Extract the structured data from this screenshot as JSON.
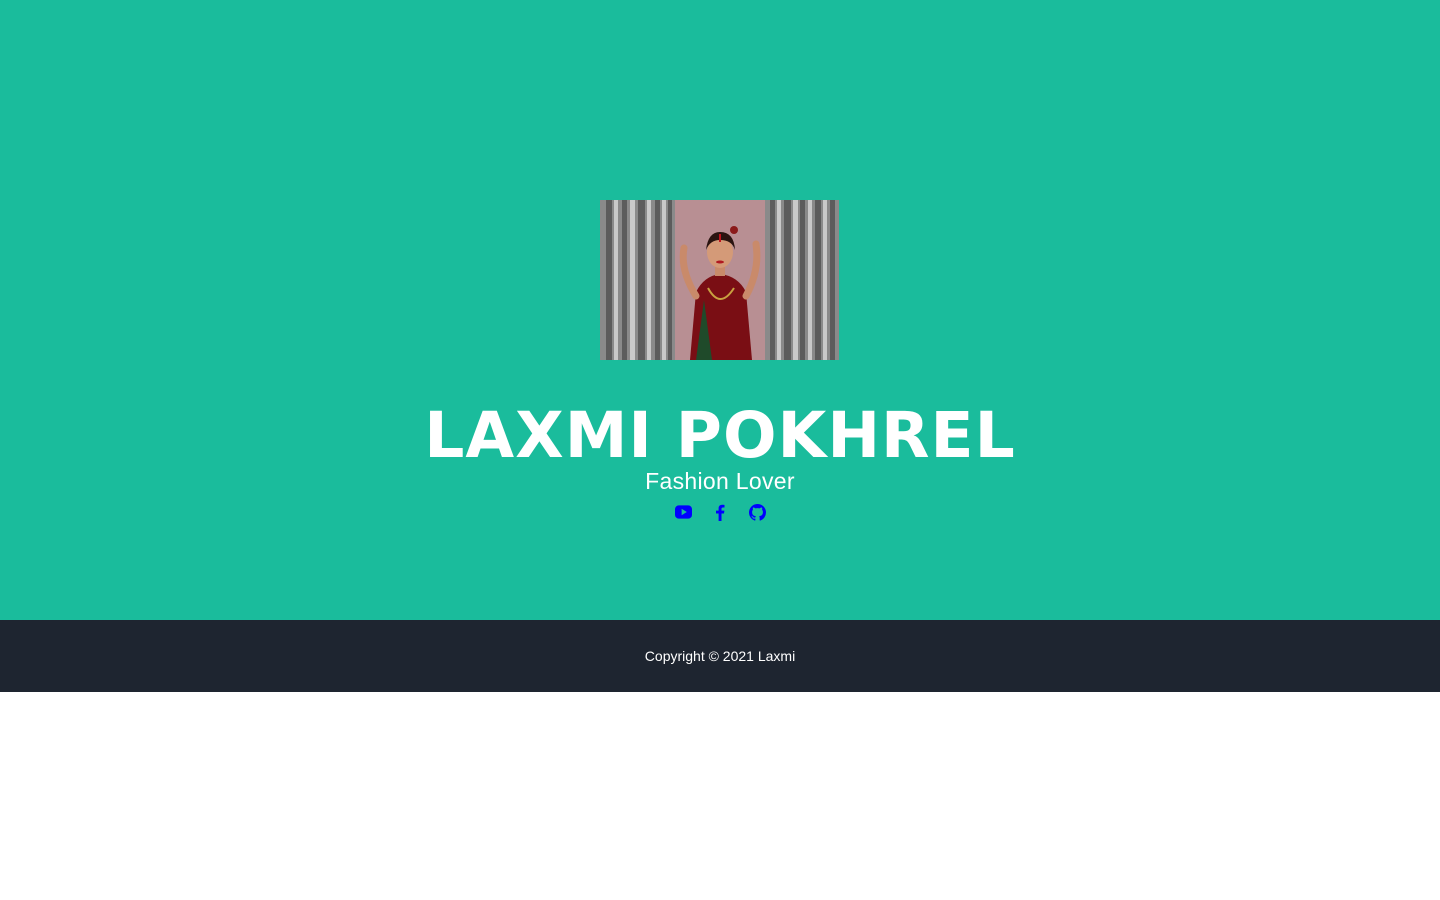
{
  "profile": {
    "name": "LAXMI POKHREL",
    "tagline": "Fashion Lover"
  },
  "social": [
    {
      "icon": "youtube-icon",
      "color": "#0000ff"
    },
    {
      "icon": "facebook-icon",
      "color": "#0000ff"
    },
    {
      "icon": "github-icon",
      "color": "#0000ff"
    }
  ],
  "footer": {
    "copyright": "Copyright © 2021 Laxmi"
  },
  "colors": {
    "hero_bg": "#1abc9c",
    "footer_bg": "#1e2530",
    "text": "#ffffff",
    "icon": "#0000ff"
  }
}
